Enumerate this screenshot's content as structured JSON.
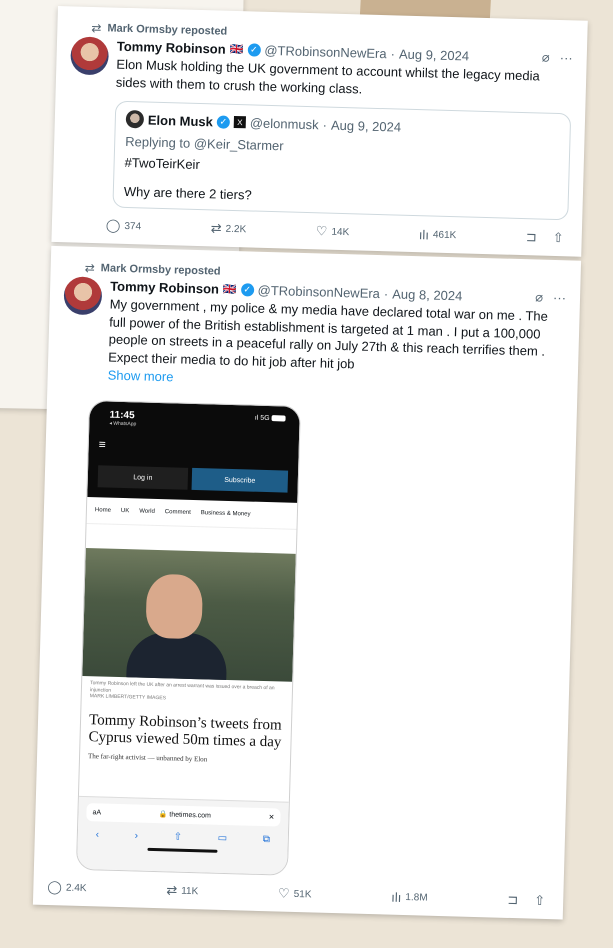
{
  "tweet1": {
    "reposted_by": "Mark Ormsby reposted",
    "name": "Tommy Robinson",
    "flag": "🇬🇧",
    "handle": "@TRobinsonNewEra",
    "date": "Aug 9, 2024",
    "text": "Elon Musk holding the UK government to account whilst the legacy media sides with them to crush the working class.",
    "quote": {
      "name": "Elon Musk",
      "handle": "@elonmusk",
      "date": "Aug 9, 2024",
      "reply_to": "Replying to @Keir_Starmer",
      "hashtag": "#TwoTeirKeir",
      "body": "Why are there 2 tiers?"
    },
    "stats": {
      "replies": "374",
      "reposts": "2.2K",
      "likes": "14K",
      "views": "461K"
    }
  },
  "tweet2": {
    "reposted_by": "Mark Ormsby reposted",
    "name": "Tommy Robinson",
    "flag": "🇬🇧",
    "handle": "@TRobinsonNewEra",
    "date": "Aug 8, 2024",
    "text": "My government , my police & my media have declared total war on me . The full power of the British establishment is targeted at 1 man . I put a 100,000 people on streets in a peaceful rally on July 27th & this reach terrifies them . Expect their media to do hit job after hit job",
    "show_more": "Show more",
    "stats": {
      "replies": "2.4K",
      "reposts": "11K",
      "likes": "51K",
      "views": "1.8M"
    }
  },
  "phone": {
    "time": "11:45",
    "sub_status": "◂ WhatsApp",
    "signal": "ıl 5G",
    "login": "Log in",
    "subscribe": "Subscribe",
    "nav": [
      "Home",
      "UK",
      "World",
      "Comment",
      "Business & Money"
    ],
    "caption": "Tommy Robinson left the UK after an arrest warrant was issued over a breach of an injunction",
    "caption_credit": "MARK LIMBERT/GETTY IMAGES",
    "headline": "Tommy Robinson’s tweets from Cyprus viewed 50m times a day",
    "standfirst": "The far-right activist — unbanned by Elon",
    "url_aa": "aA",
    "url": "🔒 thetimes.com",
    "url_close": "✕"
  },
  "colors": {
    "verified": "#1d9bf0",
    "link": "#1d9bf0",
    "muted": "#536471",
    "subscribe": "#1e5d88"
  }
}
